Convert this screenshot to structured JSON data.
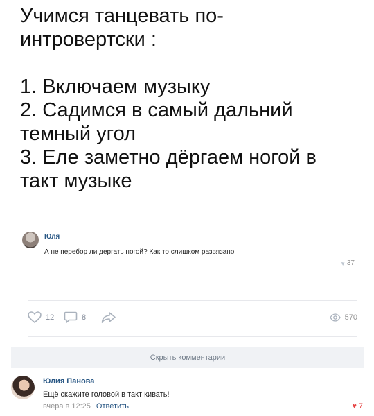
{
  "post": {
    "text": "Учимся танцевать по-\nинтровертски :\n\n1. Включаем музыку\n2. Садимся в самый дальний\nтемный угол\n3. Еле заметно дёргаем ногой в\nтакт музыке"
  },
  "embedded_comment": {
    "author": "Юля",
    "text": "А не перебор ли дергать ногой? Как то слишком развязано",
    "likes": "37"
  },
  "actions": {
    "likes": "12",
    "comments": "8",
    "views": "570"
  },
  "comments": {
    "hide_label": "Скрыть комментарии",
    "items": [
      {
        "author": "Юлия Панова",
        "text": "Ещё скажите головой в такт кивать!",
        "time": "вчера в 12:25",
        "reply_label": "Ответить",
        "likes": "7"
      }
    ]
  },
  "colors": {
    "link": "#2a5885",
    "muted": "#939393",
    "liked": "#e64646"
  }
}
